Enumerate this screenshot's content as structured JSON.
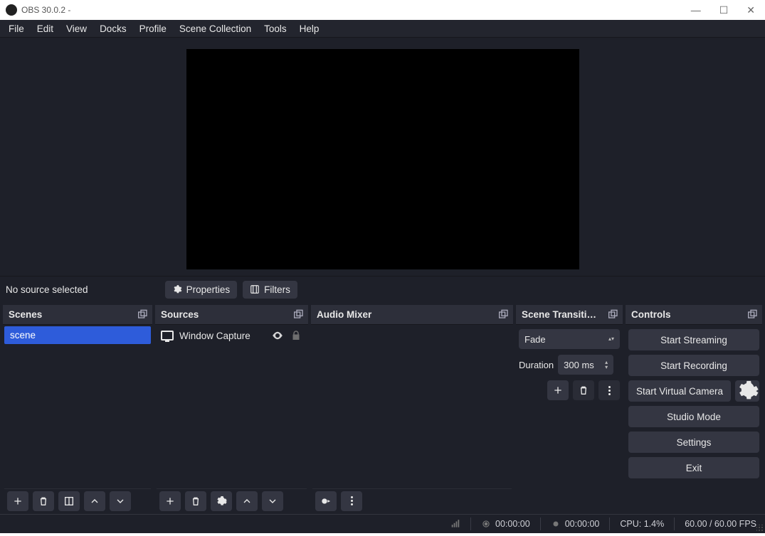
{
  "titlebar": {
    "title": "OBS 30.0.2 -"
  },
  "menu": {
    "file": "File",
    "edit": "Edit",
    "view": "View",
    "docks": "Docks",
    "profile": "Profile",
    "scene_collection": "Scene Collection",
    "tools": "Tools",
    "help": "Help"
  },
  "preview_toolbar": {
    "no_source": "No source selected",
    "properties": "Properties",
    "filters": "Filters"
  },
  "docks": {
    "scenes": {
      "title": "Scenes",
      "items": [
        "scene"
      ],
      "selected_index": 0
    },
    "sources": {
      "title": "Sources",
      "items": [
        {
          "name": "Window Capture",
          "visible": true,
          "locked": true
        }
      ]
    },
    "mixer": {
      "title": "Audio Mixer"
    },
    "transitions": {
      "title": "Scene Transiti…",
      "selected": "Fade",
      "duration_label": "Duration",
      "duration_value": "300 ms"
    },
    "controls": {
      "title": "Controls",
      "start_streaming": "Start Streaming",
      "start_recording": "Start Recording",
      "start_virtual_camera": "Start Virtual Camera",
      "studio_mode": "Studio Mode",
      "settings": "Settings",
      "exit": "Exit"
    }
  },
  "statusbar": {
    "live_time": "00:00:00",
    "rec_time": "00:00:00",
    "cpu": "CPU: 1.4%",
    "fps": "60.00 / 60.00 FPS"
  }
}
